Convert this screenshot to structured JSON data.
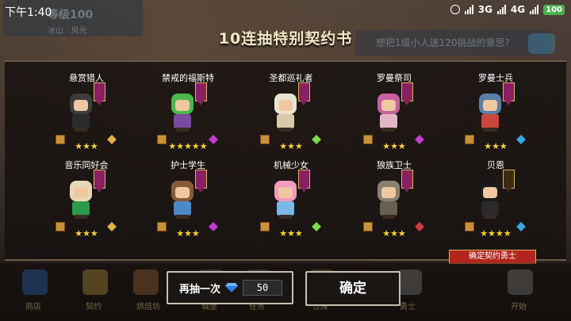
{
  "status_bar": {
    "time": "下午1:40",
    "network": "3G",
    "network2": "4G",
    "battery": "100"
  },
  "background": {
    "level_text": "等级100",
    "location_text": "冰山 · 风光",
    "banner_text": "想把1级小人送120挑战的意思?"
  },
  "title": "10连抽特别契约书",
  "cards": [
    {
      "name": "悬赏猎人",
      "stars": "★★★",
      "head_color": "#3c3c3c",
      "body_color": "#2b2b2b",
      "weapon_color": "#e2b24a",
      "flag": "purple"
    },
    {
      "name": "禁戒的福斯特",
      "stars": "★★★★★",
      "head_color": "#4bb84b",
      "body_color": "#7a4aa0",
      "weapon_color": "#c43ad1",
      "flag": "purple"
    },
    {
      "name": "圣都巡礼者",
      "stars": "★★★",
      "head_color": "#e9e4d2",
      "body_color": "#d8c9a8",
      "weapon_color": "#7bdc4a",
      "flag": "purple"
    },
    {
      "name": "罗曼祭司",
      "stars": "★★★",
      "head_color": "#c85fa0",
      "body_color": "#e2b6c6",
      "weapon_color": "#c43ad1",
      "flag": "purple"
    },
    {
      "name": "罗曼士兵",
      "stars": "★★★",
      "head_color": "#5a7fa8",
      "body_color": "#c9483a",
      "weapon_color": "#3aa6e2",
      "flag": "purple"
    },
    {
      "name": "音乐同好会",
      "stars": "★★★",
      "head_color": "#e6d9b8",
      "body_color": "#2b9a4a",
      "weapon_color": "#e2b24a",
      "flag": "purple"
    },
    {
      "name": "护士学生",
      "stars": "★★★",
      "head_color": "#8a5a38",
      "body_color": "#4a8ac9",
      "weapon_color": "#c43ad1",
      "flag": "purple"
    },
    {
      "name": "机械少女",
      "stars": "★★★",
      "head_color": "#f29ac0",
      "body_color": "#7ab8e6",
      "weapon_color": "#7bdc4a",
      "flag": "purple"
    },
    {
      "name": "狼族卫士",
      "stars": "★★★",
      "head_color": "#8a8070",
      "body_color": "#6a6050",
      "weapon_color": "#d13a3a",
      "flag": "purple"
    },
    {
      "name": "贝恩",
      "stars": "★★★★",
      "head_color": "#1a1a1a",
      "body_color": "#2a2a2a",
      "weapon_color": "#3aa6e2",
      "flag": "gold"
    }
  ],
  "confirm_tag": "确定契约勇士",
  "buttons": {
    "again_label": "再抽一次",
    "again_cost": "50",
    "confirm_label": "确定"
  },
  "bottom_nav": [
    "商店",
    "契约",
    "烘焙坊",
    "城堡",
    "任务",
    "仓库",
    "勇士",
    "开始"
  ]
}
